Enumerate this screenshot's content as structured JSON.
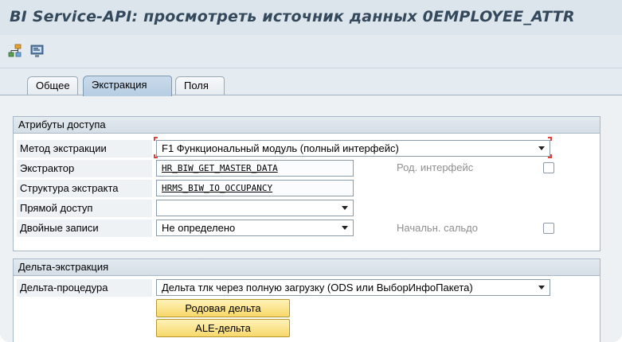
{
  "window": {
    "title": "BI Service-API: просмотреть источник данных 0EMPLOYEE_ATTR"
  },
  "toolbar": {
    "icons": [
      "hierarchy-icon",
      "display-icon"
    ]
  },
  "tabs": [
    {
      "label": "Общее",
      "active": false
    },
    {
      "label": "Экстракция",
      "active": true
    },
    {
      "label": "Поля",
      "active": false
    }
  ],
  "access": {
    "group_title": "Атрибуты доступа",
    "method_label": "Метод экстракции",
    "method_value": "F1 Функциональный модуль (полный интерфейс)",
    "extractor_label": "Экстрактор",
    "extractor_value": "HR_BIW_GET_MASTER_DATA",
    "generic_interface_label": "Род. интерфейс",
    "structure_label": "Структура экстракта",
    "structure_value": "HRMS_BIW_IO_OCCUPANCY",
    "direct_access_label": "Прямой доступ",
    "direct_access_value": "",
    "duplicates_label": "Двойные записи",
    "duplicates_value": "Не определено",
    "opening_balance_label": "Начальн. сальдо"
  },
  "delta": {
    "group_title": "Дельта-экстракция",
    "procedure_label": "Дельта-процедура",
    "procedure_value": "Дельта тлк через полную загрузку (ODS или ВыборИнфоПакета)",
    "generic_delta_button": "Родовая дельта",
    "ale_delta_button": "ALE-дельта"
  },
  "colors": {
    "title_text": "#34495c",
    "yellow_button": "#f7d86a",
    "focus_marker": "#e0413a"
  }
}
